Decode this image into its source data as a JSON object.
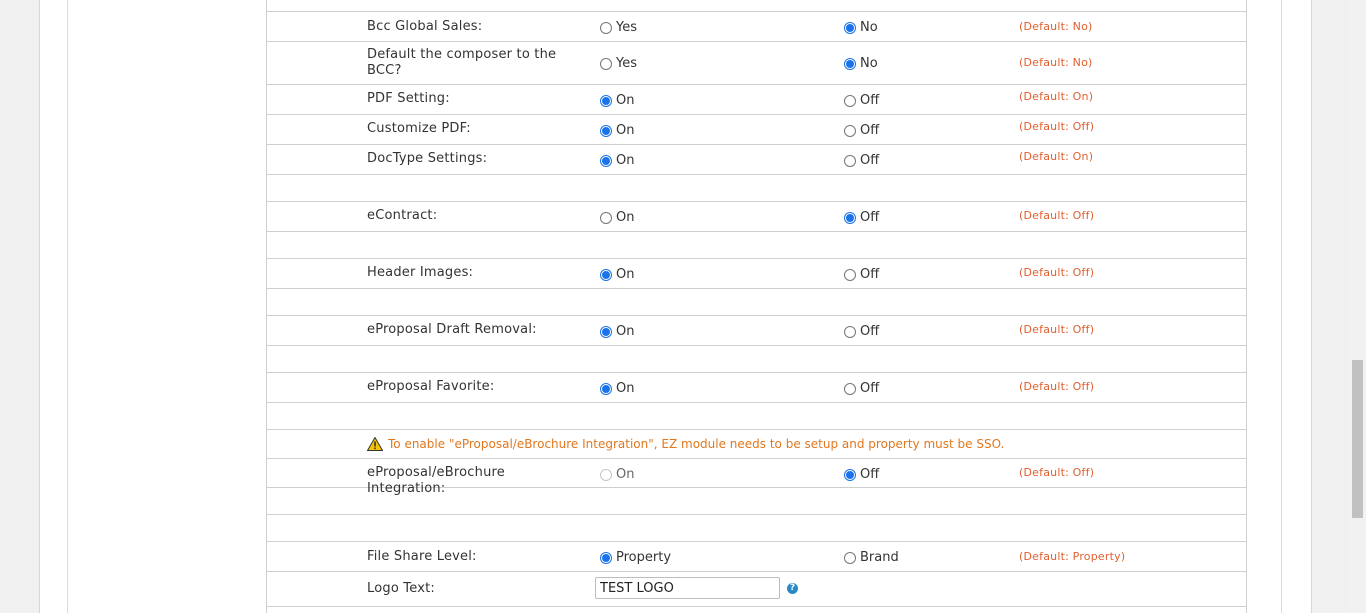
{
  "rows": [
    {
      "label": "Bcc Global Sales:",
      "a": "Yes",
      "b": "No",
      "selected": "b",
      "default": "(Default: No)"
    },
    {
      "label": "Default the composer to the BCC?",
      "a": "Yes",
      "b": "No",
      "selected": "b",
      "default": "(Default: No)"
    },
    {
      "label": "PDF Setting:",
      "a": "On",
      "b": "Off",
      "selected": "a",
      "default": "(Default: On)"
    },
    {
      "label": "Customize PDF:",
      "a": "On",
      "b": "Off",
      "selected": "a",
      "default": "(Default: Off)"
    },
    {
      "label": "DocType Settings:",
      "a": "On",
      "b": "Off",
      "selected": "a",
      "default": "(Default: On)"
    },
    {
      "label": "eContract:",
      "a": "On",
      "b": "Off",
      "selected": "b",
      "default": "(Default: Off)"
    },
    {
      "label": "Header Images:",
      "a": "On",
      "b": "Off",
      "selected": "a",
      "default": "(Default: Off)"
    },
    {
      "label": "eProposal Draft Removal:",
      "a": "On",
      "b": "Off",
      "selected": "a",
      "default": "(Default: Off)"
    },
    {
      "label": "eProposal Favorite:",
      "a": "On",
      "b": "Off",
      "selected": "a",
      "default": "(Default: Off)"
    },
    {
      "label": "eProposal/eBrochure Integration:",
      "a": "On",
      "b": "Off",
      "selected": "b",
      "default": "(Default: Off)",
      "a_disabled": true
    },
    {
      "label": "File Share Level:",
      "a": "Property",
      "b": "Brand",
      "selected": "a",
      "default": "(Default: Property)"
    }
  ],
  "warning": {
    "text": "To enable \"eProposal/eBrochure Integration\", EZ module needs to be setup and property must be SSO.",
    "icon": "warning-icon"
  },
  "logo": {
    "label": "Logo Text:",
    "value": "TEST LOGO",
    "help_icon": "help-icon"
  },
  "colors": {
    "accent": "#1a73e8",
    "default_text": "#e06030",
    "warning_text": "#e07820"
  }
}
